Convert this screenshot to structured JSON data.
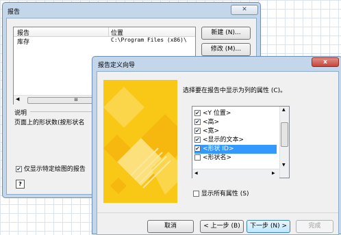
{
  "report_window": {
    "title": "报告",
    "columns": [
      "报告",
      "位置"
    ],
    "rows": [
      {
        "name": "库存",
        "location": "C:\\Program Files (x86)\\"
      }
    ],
    "new_button": "新建 (N)...",
    "modify_button": "修改 (M)...",
    "description_label": "说明",
    "description_text": "页面上的形状数(按形状名",
    "filter_checkbox_label": "仅显示特定绘图的报告",
    "filter_checked": true,
    "scroll_mid": "III"
  },
  "wizard": {
    "title": "报告定义向导",
    "prompt": "选择要在报告中显示为列的属性 (C)。",
    "properties": [
      {
        "label": "<Y 位置>",
        "checked": true,
        "selected": false
      },
      {
        "label": "<高>",
        "checked": true,
        "selected": false
      },
      {
        "label": "<宽>",
        "checked": true,
        "selected": false
      },
      {
        "label": "<显示的文本>",
        "checked": true,
        "selected": false
      },
      {
        "label": "<形状 ID>",
        "checked": true,
        "selected": true
      },
      {
        "label": "<形状名>",
        "checked": false,
        "selected": false
      }
    ],
    "show_all_label": "显示所有属性 (S)",
    "show_all_checked": false,
    "buttons": {
      "cancel": "取消",
      "back": "< 上一步 (B)",
      "next": "下一步 (N) >",
      "finish": "完成"
    },
    "close_glyph": "x"
  },
  "colors": {
    "accent": "#3399ff",
    "wizard_title": "#c3d6ea",
    "close": "#c8453a",
    "banner": "#f9c716"
  }
}
